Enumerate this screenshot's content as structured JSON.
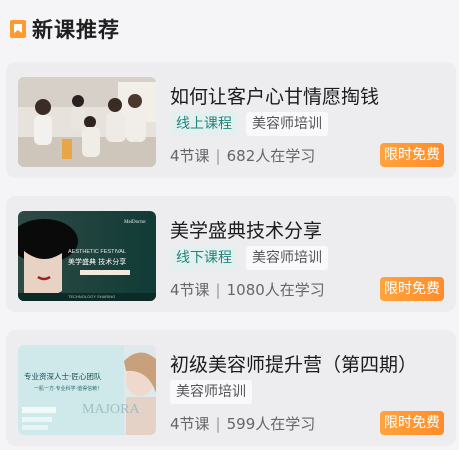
{
  "section": {
    "title": "新课推荐"
  },
  "courses": [
    {
      "title": "如何让客户心甘情愿掏钱",
      "tags": [
        "线上课程",
        "美容师培训"
      ],
      "lessons": "4节课",
      "learners": "682人在学习",
      "cta": "限时免费"
    },
    {
      "title": "美学盛典技术分享",
      "tags": [
        "线下课程",
        "美容师培训"
      ],
      "lessons": "4节课",
      "learners": "1080人在学习",
      "cta": "限时免费",
      "thumb": {
        "brand": "MeiDoctor",
        "line1": "AESTHETIC FESTIVAL",
        "line2": "美学盛典  技术分享",
        "line3": "TECHNOLOGY SHARING"
      }
    },
    {
      "title": "初级美容师提升营（第四期）",
      "tags": [
        "美容师培训"
      ],
      "lessons": "4节课",
      "learners": "599人在学习",
      "cta": "限时免费",
      "thumb": {
        "line1": "专业资深人士·匠心团队",
        "line2": "一肌一方·专业科学·值得信赖！",
        "brand": "MAJORA"
      }
    }
  ],
  "colors": {
    "accent": "#ff8c2a",
    "teal": "#22857a"
  }
}
